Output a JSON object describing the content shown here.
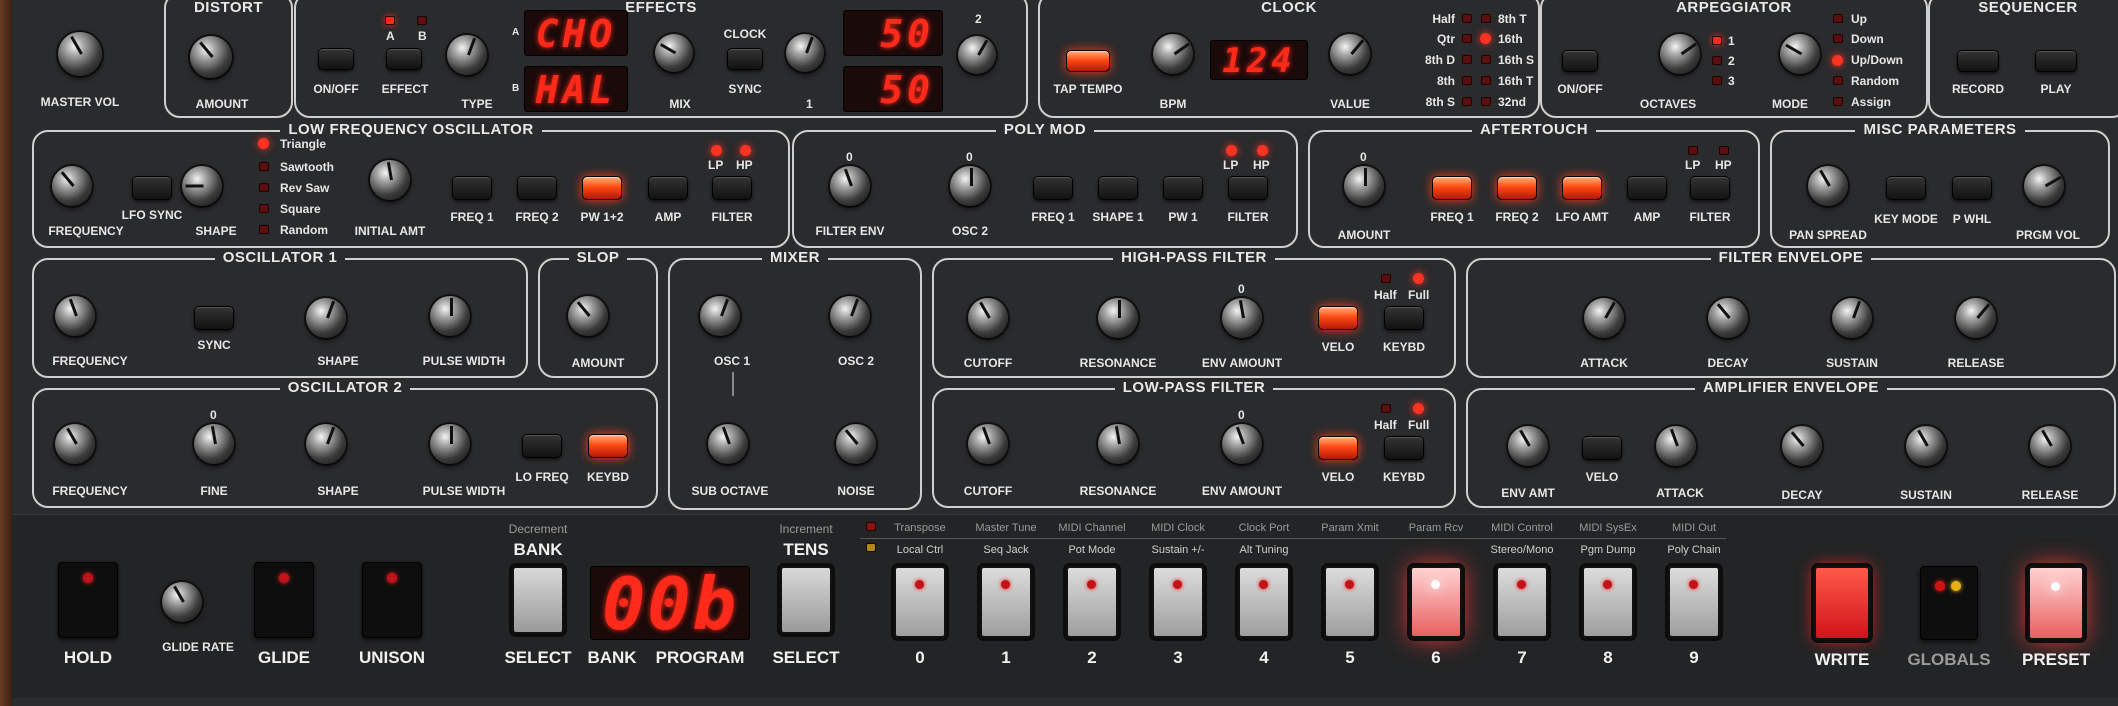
{
  "top": {
    "master_vol": "MASTER VOL",
    "distort": {
      "title": "DISTORT",
      "amount": "AMOUNT"
    },
    "effects": {
      "title": "EFFECTS",
      "onoff": "ON/OFF",
      "effect": "EFFECT",
      "a": "A",
      "b": "B",
      "type": "TYPE",
      "disp_a": "CHO",
      "disp_b": "HAL",
      "mix": "MIX",
      "clock": "CLOCK",
      "sync": "SYNC",
      "one": "1",
      "two": "2",
      "val1": "50",
      "val2": "50"
    },
    "clock": {
      "title": "CLOCK",
      "tap_tempo": "TAP TEMPO",
      "bpm": "BPM",
      "bpm_value": "124",
      "value": "VALUE",
      "divs_left": [
        "Half",
        "Qtr",
        "8th D",
        "8th",
        "8th S"
      ],
      "divs_right": [
        "8th T",
        "16th",
        "16th S",
        "16th T",
        "32nd"
      ],
      "active": "16th"
    },
    "arpeggiator": {
      "title": "ARPEGGIATOR",
      "onoff": "ON/OFF",
      "octaves": "OCTAVES",
      "oct_opts": [
        "1",
        "2",
        "3"
      ],
      "mode": "MODE",
      "modes": [
        "Up",
        "Down",
        "Up/Down",
        "Random",
        "Assign"
      ],
      "active_mode": "Up/Down"
    },
    "sequencer": {
      "title": "SEQUENCER",
      "record": "RECORD",
      "play": "PLAY"
    }
  },
  "lfo": {
    "title": "LOW FREQUENCY OSCILLATOR",
    "frequency": "FREQUENCY",
    "lfo_sync": "LFO SYNC",
    "shape": "SHAPE",
    "shapes": [
      "Triangle",
      "Sawtooth",
      "Rev Saw",
      "Square",
      "Random"
    ],
    "initial_amt": "INITIAL AMT",
    "freq1": "FREQ 1",
    "freq2": "FREQ 2",
    "pw12": "PW 1+2",
    "amp": "AMP",
    "filter": "FILTER",
    "lp": "LP",
    "hp": "HP"
  },
  "polymod": {
    "title": "POLY MOD",
    "filter_env": "FILTER ENV",
    "osc2": "OSC 2",
    "freq1": "FREQ 1",
    "shape1": "SHAPE 1",
    "pw1": "PW 1",
    "filter": "FILTER",
    "lp": "LP",
    "hp": "HP",
    "zero": "0"
  },
  "aftertouch": {
    "title": "AFTERTOUCH",
    "amount": "AMOUNT",
    "freq1": "FREQ 1",
    "freq2": "FREQ 2",
    "lfo_amt": "LFO AMT",
    "amp": "AMP",
    "filter": "FILTER",
    "lp": "LP",
    "hp": "HP",
    "zero": "0"
  },
  "misc": {
    "title": "MISC PARAMETERS",
    "pan_spread": "PAN SPREAD",
    "key_mode": "KEY MODE",
    "p_whl": "P WHL",
    "prgm_vol": "PRGM VOL"
  },
  "osc1": {
    "title": "OSCILLATOR 1",
    "frequency": "FREQUENCY",
    "sync": "SYNC",
    "shape": "SHAPE",
    "pulse_width": "PULSE WIDTH"
  },
  "slop": {
    "title": "SLOP",
    "amount": "AMOUNT"
  },
  "mixer": {
    "title": "MIXER",
    "osc1": "OSC 1",
    "osc2": "OSC 2",
    "sub_octave": "SUB OCTAVE",
    "noise": "NOISE"
  },
  "hpf": {
    "title": "HIGH-PASS FILTER",
    "cutoff": "CUTOFF",
    "resonance": "RESONANCE",
    "env_amount": "ENV AMOUNT",
    "velo": "VELO",
    "keybd": "KEYBD",
    "half": "Half",
    "full": "Full",
    "zero": "0"
  },
  "fenv": {
    "title": "FILTER ENVELOPE",
    "attack": "ATTACK",
    "decay": "DECAY",
    "sustain": "SUSTAIN",
    "release": "RELEASE"
  },
  "osc2": {
    "title": "OSCILLATOR 2",
    "frequency": "FREQUENCY",
    "fine": "FINE",
    "shape": "SHAPE",
    "pulse_width": "PULSE WIDTH",
    "lo_freq": "LO FREQ",
    "keybd": "KEYBD",
    "zero": "0"
  },
  "lpf": {
    "title": "LOW-PASS FILTER",
    "cutoff": "CUTOFF",
    "resonance": "RESONANCE",
    "env_amount": "ENV AMOUNT",
    "velo": "VELO",
    "keybd": "KEYBD",
    "half": "Half",
    "full": "Full",
    "zero": "0"
  },
  "aenv": {
    "title": "AMPLIFIER ENVELOPE",
    "env_amt": "ENV AMT",
    "velo": "VELO",
    "attack": "ATTACK",
    "decay": "DECAY",
    "sustain": "SUSTAIN",
    "release": "RELEASE"
  },
  "bottom": {
    "hold": "HOLD",
    "glide_rate": "GLIDE RATE",
    "glide": "GLIDE",
    "unison": "UNISON",
    "decrement": "Decrement",
    "bank_top": "BANK",
    "select": "SELECT",
    "bank": "BANK",
    "program": "PROGRAM",
    "display": "00b",
    "increment": "Increment",
    "tens": "TENS",
    "legend_top": [
      "Transpose",
      "Master Tune",
      "MIDI Channel",
      "MIDI Clock",
      "Clock Port",
      "Param Xmit",
      "Param Rcv",
      "MIDI Control",
      "MIDI SysEx",
      "MIDI Out"
    ],
    "legend_bottom": [
      "Local Ctrl",
      "Seq Jack",
      "Pot Mode",
      "Sustain +/-",
      "Alt Tuning",
      "",
      "",
      "Stereo/Mono",
      "Pgm Dump",
      "Poly Chain"
    ],
    "digits": [
      "0",
      "1",
      "2",
      "3",
      "4",
      "5",
      "6",
      "7",
      "8",
      "9"
    ],
    "lit_digit": "6",
    "write": "WRITE",
    "globals": "GLOBALS",
    "preset": "PRESET"
  },
  "colors": {
    "panel": "#2a2b2d",
    "led_red": "#ff2a1a",
    "button_on": "#ff4a14",
    "outline": "#cfcfcf"
  }
}
